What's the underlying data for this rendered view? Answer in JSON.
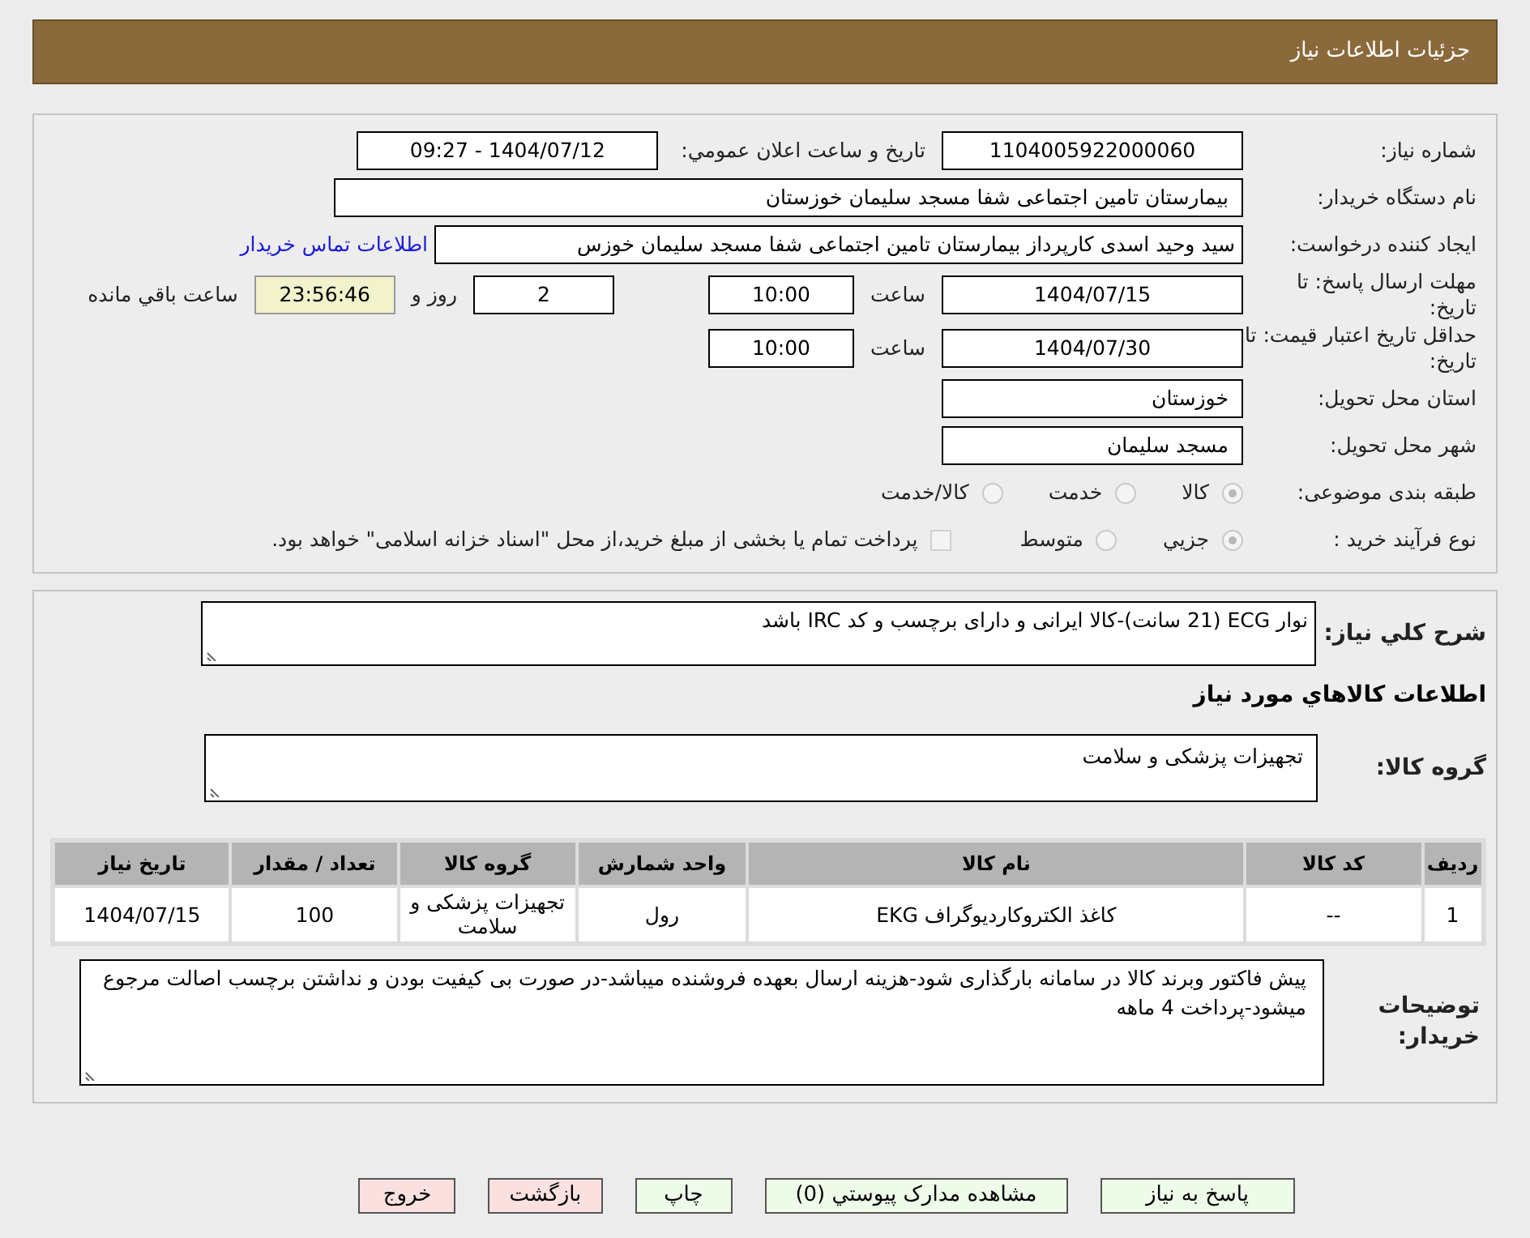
{
  "header": {
    "title": "جزئیات اطلاعات نیاز"
  },
  "need_number": {
    "label": "شماره نیاز:",
    "value": "1104005922000060"
  },
  "announce": {
    "label": "تاریخ و ساعت اعلان عمومي:",
    "value": "1404/07/12 - 09:27"
  },
  "buyer_org": {
    "label": "نام دستگاه خریدار:",
    "value": "بیمارستان تامین اجتماعی شفا مسجد سلیمان خوزستان"
  },
  "requester": {
    "label": "ایجاد کننده درخواست:",
    "value": "سید وحید اسدی کارپرداز بیمارستان تامین اجتماعی شفا مسجد سلیمان خوزس",
    "link": "اطلاعات تماس خریدار"
  },
  "deadline": {
    "label": "مهلت ارسال پاسخ: تا تاریخ:",
    "date": "1404/07/15",
    "time_label": "ساعت",
    "time": "10:00",
    "days": "2",
    "days_label": "روز و",
    "remaining": "23:56:46",
    "remaining_label": "ساعت باقي مانده"
  },
  "validity": {
    "label": "حداقل تاریخ اعتبار قیمت: تا تاریخ:",
    "date": "1404/07/30",
    "time_label": "ساعت",
    "time": "10:00"
  },
  "province": {
    "label": "استان محل تحویل:",
    "value": "خوزستان"
  },
  "city": {
    "label": "شهر محل تحویل:",
    "value": "مسجد سلیمان"
  },
  "category": {
    "label": "طبقه بندی موضوعی:",
    "options": [
      {
        "label": "کالا",
        "selected": true
      },
      {
        "label": "خدمت",
        "selected": false
      },
      {
        "label": "کالا/خدمت",
        "selected": false
      }
    ]
  },
  "process": {
    "label": "نوع فرآیند خرید :",
    "options": [
      {
        "label": "جزيي",
        "selected": true
      },
      {
        "label": "متوسط",
        "selected": false
      }
    ],
    "treasury": {
      "label": "پرداخت تمام یا بخشی از مبلغ خرید،از محل \"اسناد خزانه اسلامی\" خواهد بود.",
      "checked": false
    }
  },
  "summary": {
    "label": "شرح کلي نیاز:",
    "value": "نوار ECG (21 سانت)-کالا ایرانی و دارای برچسب  و کد IRC باشد"
  },
  "goods_heading": "اطلاعات کالاهاي مورد نیاز",
  "goods_group": {
    "label": "گروه کالا:",
    "value": "تجهیزات پزشکی و سلامت"
  },
  "table": {
    "columns": [
      "ردیف",
      "کد کالا",
      "نام کالا",
      "واحد شمارش",
      "گروه کالا",
      "تعداد / مقدار",
      "تاریخ نیاز"
    ],
    "rows": [
      [
        "1",
        "--",
        "کاغذ الکتروکاردیوگراف EKG",
        "رول",
        "تجهیزات پزشکی و سلامت",
        "100",
        "1404/07/15"
      ]
    ]
  },
  "notes": {
    "label": "توضیحات خریدار:",
    "value": "پیش فاکتور وبرند کالا در سامانه بارگذاری شود-هزینه ارسال بعهده فروشنده میباشد-در صورت بی کیفیت بودن و نداشتن برچسب اصالت مرجوع میشود-پرداخت 4 ماهه"
  },
  "buttons": [
    {
      "label": "پاسخ به نیاز",
      "kind": "green"
    },
    {
      "label": "مشاهده مدارک پیوستي (0)",
      "kind": "green"
    },
    {
      "label": "چاپ",
      "kind": "green"
    },
    {
      "label": "بازگشت",
      "kind": "red"
    },
    {
      "label": "خروج",
      "kind": "red"
    }
  ]
}
